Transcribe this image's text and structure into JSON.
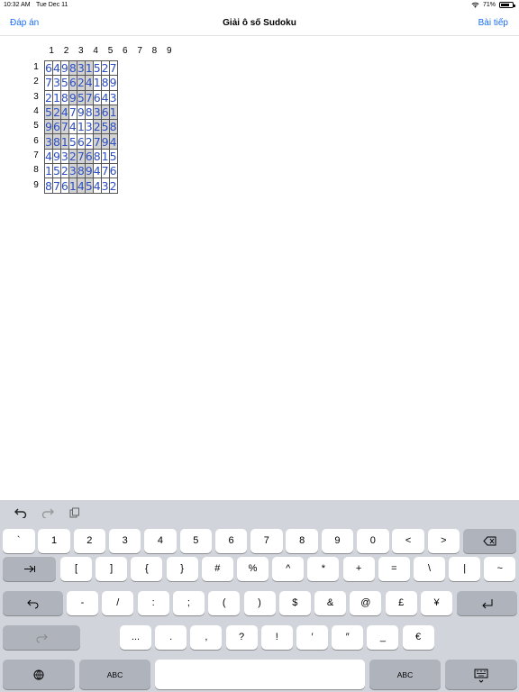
{
  "status": {
    "time": "10:32 AM",
    "date": "Tue Dec 11",
    "battery": "71%",
    "battery_level": 0.71
  },
  "nav": {
    "left": "Đáp án",
    "title": "Giải ô số Sudoku",
    "right": "Bài tiếp"
  },
  "grid": {
    "col_headers": [
      "1",
      "2",
      "3",
      "4",
      "5",
      "6",
      "7",
      "8",
      "9"
    ],
    "row_headers": [
      "1",
      "2",
      "3",
      "4",
      "5",
      "6",
      "7",
      "8",
      "9"
    ],
    "rows": [
      [
        "6",
        "4",
        "9",
        "8",
        "3",
        "1",
        "5",
        "2",
        "7"
      ],
      [
        "7",
        "3",
        "5",
        "6",
        "2",
        "4",
        "1",
        "8",
        "9"
      ],
      [
        "2",
        "1",
        "8",
        "9",
        "5",
        "7",
        "6",
        "4",
        "3"
      ],
      [
        "5",
        "2",
        "4",
        "7",
        "9",
        "8",
        "3",
        "6",
        "1"
      ],
      [
        "9",
        "6",
        "7",
        "4",
        "1",
        "3",
        "2",
        "5",
        "8"
      ],
      [
        "3",
        "8",
        "1",
        "5",
        "6",
        "2",
        "7",
        "9",
        "4"
      ],
      [
        "4",
        "9",
        "3",
        "2",
        "7",
        "6",
        "8",
        "1",
        "5"
      ],
      [
        "1",
        "5",
        "2",
        "3",
        "8",
        "9",
        "4",
        "7",
        "6"
      ],
      [
        "8",
        "7",
        "6",
        "1",
        "4",
        "5",
        "4",
        "3",
        "2"
      ]
    ]
  },
  "keyboard": {
    "row1": [
      "`",
      "1",
      "2",
      "3",
      "4",
      "5",
      "6",
      "7",
      "8",
      "9",
      "0",
      "<",
      ">"
    ],
    "row2": [
      "[",
      "]",
      "{",
      "}",
      "#",
      "%",
      "^",
      "*",
      "+",
      "=",
      "\\",
      "|",
      "~"
    ],
    "row3": [
      "-",
      "/",
      ":",
      ";",
      "(",
      ")",
      "$",
      "&",
      "@",
      "£",
      "¥"
    ],
    "row4": [
      "...",
      ".",
      ",",
      "?",
      "!",
      "′",
      "″",
      "_",
      "€"
    ],
    "abc_left": "ABC",
    "abc_right": "ABC"
  }
}
